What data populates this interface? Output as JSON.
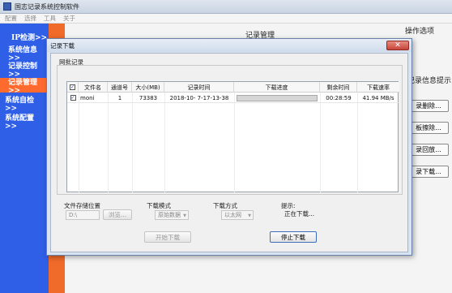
{
  "window": {
    "title": "国志记录系统控制软件"
  },
  "menubar": {
    "items": [
      "配置",
      "选择",
      "工具",
      "关于"
    ]
  },
  "sidebar": {
    "items": [
      {
        "label": "IP检测>>"
      },
      {
        "label": "系统信息>>"
      },
      {
        "label": "记录控制>>"
      },
      {
        "label": "记录管理 >>"
      },
      {
        "label": "系统自检 >>"
      },
      {
        "label": "系统配置 >>"
      }
    ],
    "active_index": 3
  },
  "background": {
    "title": "记录管理",
    "ops_label": "操作选项",
    "record_info_label": "记录信息提示",
    "buttons": [
      "录删除...",
      "板擦除...",
      "录回放...",
      "录下载..."
    ]
  },
  "dialog": {
    "title": "记录下载",
    "close_label": "✕",
    "group_label": "网批记录",
    "table": {
      "headers": [
        "",
        "文件名",
        "通道号",
        "大小(MB)",
        "记录时间",
        "下载进度",
        "剩余时间",
        "下载速率"
      ],
      "rows": [
        {
          "checked": true,
          "filename": "moni",
          "channel": "1",
          "size": "73383",
          "record_time": "2018-10- 7-17-13-38",
          "progress": 0.0,
          "remaining": "00:28:59",
          "rate": "41.94 MB/s"
        }
      ]
    },
    "storage": {
      "label": "文件存储位置",
      "path": "D:\\",
      "browse_label": "浏览..."
    },
    "mode": {
      "label": "下载模式",
      "value": "原始数据"
    },
    "method": {
      "label": "下载方式",
      "value": "以太网"
    },
    "hint": {
      "label": "提示:",
      "text": "正在下载..."
    },
    "start_label": "开始下载",
    "stop_label": "停止下载"
  },
  "colors": {
    "sidebar": "#2f5fe6",
    "accent": "#f06a2a",
    "progress": "#06b025"
  }
}
